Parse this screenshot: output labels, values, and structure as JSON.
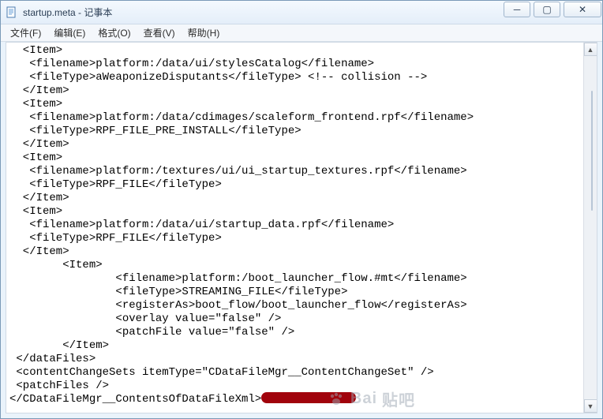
{
  "window": {
    "title": "startup.meta - 记事本",
    "min_tip": "Minimize",
    "max_tip": "Restore",
    "close_tip": "Close"
  },
  "menu": {
    "file": "文件(F)",
    "edit": "编辑(E)",
    "format": "格式(O)",
    "view": "查看(V)",
    "help": "帮助(H)"
  },
  "content": {
    "l01": "  <Item>",
    "l02": "   <filename>platform:/data/ui/stylesCatalog</filename>",
    "l03": "   <fileType>aWeaponizeDisputants</fileType> <!-- collision -->",
    "l04": "  </Item>",
    "l05": "  <Item>",
    "l06": "   <filename>platform:/data/cdimages/scaleform_frontend.rpf</filename>",
    "l07": "   <fileType>RPF_FILE_PRE_INSTALL</fileType>",
    "l08": "  </Item>",
    "l09": "  <Item>",
    "l10": "   <filename>platform:/textures/ui/ui_startup_textures.rpf</filename>",
    "l11": "   <fileType>RPF_FILE</fileType>",
    "l12": "  </Item>",
    "l13": "  <Item>",
    "l14": "   <filename>platform:/data/ui/startup_data.rpf</filename>",
    "l15": "   <fileType>RPF_FILE</fileType>",
    "l16": "  </Item>",
    "l17": "        <Item>",
    "l18": "                <filename>platform:/boot_launcher_flow.#mt</filename>",
    "l19": "                <fileType>STREAMING_FILE</fileType>",
    "l20": "                <registerAs>boot_flow/boot_launcher_flow</registerAs>",
    "l21": "                <overlay value=\"false\" />",
    "l22": "                <patchFile value=\"false\" />",
    "l23": "        </Item>",
    "l24": " </dataFiles>",
    "l25": " <contentChangeSets itemType=\"CDataFileMgr__ContentChangeSet\" />",
    "l26": " <patchFiles />",
    "l27": "</CDataFileMgr__ContentsOfDataFileXml>"
  },
  "watermark": {
    "brand": "Bai",
    "brand2": "贴吧"
  }
}
